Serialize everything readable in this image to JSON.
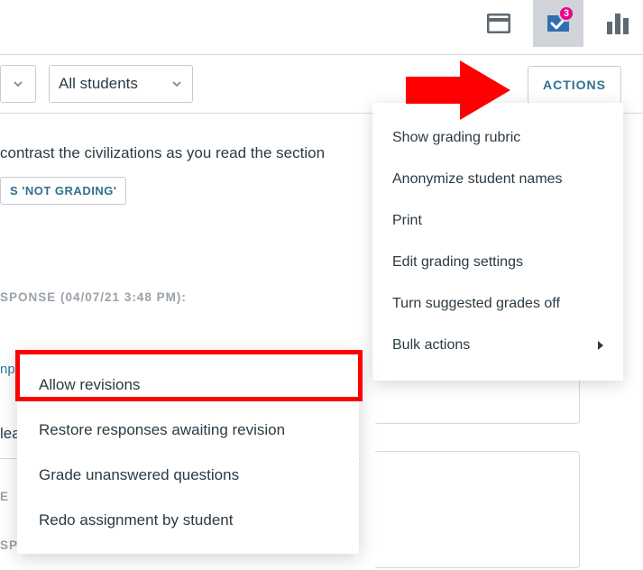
{
  "topbar": {
    "notif_count": "3"
  },
  "filters": {
    "all_students_label": "All students"
  },
  "actions_button_label": "ACTIONS",
  "body": {
    "prompt_fragment": "contrast the civilizations as you read the section",
    "chip_label": "S 'NOT GRADING'",
    "meta_fragment": "SPONSE (04/07/21 3:48 PM):",
    "link_fragment": "np",
    "text_fragment": "lea",
    "meta2_fragment": "E",
    "meta3_fragment": "SPO"
  },
  "actions_menu": {
    "items": [
      {
        "label": "Show grading rubric"
      },
      {
        "label": "Anonymize student names"
      },
      {
        "label": "Print"
      },
      {
        "label": "Edit grading settings"
      },
      {
        "label": "Turn suggested grades off"
      },
      {
        "label": "Bulk actions",
        "submenu": true
      }
    ]
  },
  "bulk_menu": {
    "items": [
      {
        "label": "Allow revisions"
      },
      {
        "label": "Restore responses awaiting revision"
      },
      {
        "label": "Grade unanswered questions"
      },
      {
        "label": "Redo assignment by student"
      }
    ]
  }
}
